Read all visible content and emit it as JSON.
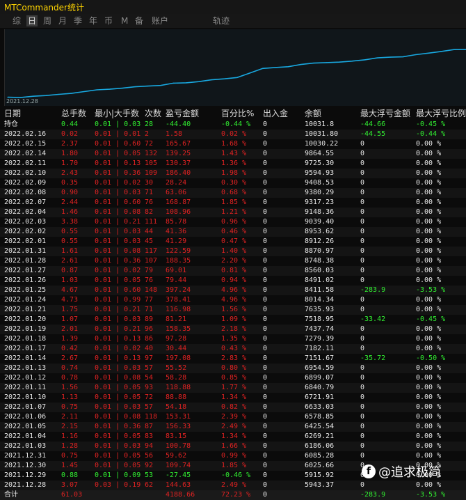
{
  "app": {
    "title": "MTCommander统计"
  },
  "tabs": [
    "综",
    "日",
    "周",
    "月",
    "季",
    "年",
    "币",
    "M",
    "备",
    "账户",
    "轨迹"
  ],
  "active_tab": "日",
  "chart": {
    "date_label": "2021.12.28"
  },
  "chart_data": {
    "type": "line",
    "x": [
      "2021.12.28",
      "2021.12.29",
      "2021.12.30",
      "2021.12.31",
      "2022.01.03",
      "2022.01.04",
      "2022.01.05",
      "2022.01.06",
      "2022.01.07",
      "2022.01.10",
      "2022.01.11",
      "2022.01.12",
      "2022.01.13",
      "2022.01.14",
      "2022.01.17",
      "2022.01.18",
      "2022.01.19",
      "2022.01.20",
      "2022.01.21",
      "2022.01.24",
      "2022.01.25",
      "2022.01.26",
      "2022.01.27",
      "2022.01.28",
      "2022.01.31",
      "2022.02.01",
      "2022.02.02",
      "2022.02.03",
      "2022.02.04",
      "2022.02.07",
      "2022.02.08",
      "2022.02.09",
      "2022.02.10",
      "2022.02.11",
      "2022.02.14",
      "2022.02.15",
      "2022.02.16"
    ],
    "series": [
      {
        "values": [
          5943.37,
          5915.92,
          6025.66,
          6085.28,
          6186.06,
          6269.21,
          6425.54,
          6578.85,
          6633.03,
          6721.91,
          6840.79,
          6899.07,
          6954.59,
          7151.67,
          7182.11,
          7279.39,
          7437.74,
          7518.95,
          7635.93,
          8014.34,
          8411.58,
          8491.02,
          8560.03,
          8748.38,
          8870.97,
          8912.26,
          8953.62,
          9039.4,
          9148.36,
          9317.23,
          9380.29,
          9408.53,
          9594.93,
          9725.3,
          9864.55,
          10030.22,
          10031.8
        ]
      }
    ]
  },
  "columns": [
    "日期",
    "总手数",
    "最小|大手数",
    "次数",
    "盈亏金额",
    "百分比%",
    "出入金",
    "余额",
    "最大浮亏金额",
    "最大浮亏比例"
  ],
  "holding": {
    "date": "持仓",
    "lots": "0.44",
    "minmax": "0.01 | 0.03",
    "count": "28",
    "pl": "-44.40",
    "pct": "-0.44 %",
    "io": "0",
    "bal": "10031.8",
    "fl": "-44.66",
    "flp": "-0.45 %"
  },
  "rows": [
    [
      "2022.02.16",
      "0.02",
      "0.01 | 0.01",
      "2",
      "1.58",
      "0.02 %",
      "0",
      "10031.80",
      "-44.55",
      "-0.44 %"
    ],
    [
      "2022.02.15",
      "2.37",
      "0.01 | 0.60",
      "72",
      "165.67",
      "1.68 %",
      "0",
      "10030.22",
      "0",
      "0.00 %"
    ],
    [
      "2022.02.14",
      "1.80",
      "0.01 | 0.05",
      "132",
      "139.25",
      "1.43 %",
      "0",
      "9864.55",
      "0",
      "0.00 %"
    ],
    [
      "2022.02.11",
      "1.70",
      "0.01 | 0.13",
      "105",
      "130.37",
      "1.36 %",
      "0",
      "9725.30",
      "0",
      "0.00 %"
    ],
    [
      "2022.02.10",
      "2.43",
      "0.01 | 0.36",
      "109",
      "186.40",
      "1.98 %",
      "0",
      "9594.93",
      "0",
      "0.00 %"
    ],
    [
      "2022.02.09",
      "0.35",
      "0.01 | 0.02",
      "30",
      "28.24",
      "0.30 %",
      "0",
      "9408.53",
      "0",
      "0.00 %"
    ],
    [
      "2022.02.08",
      "0.90",
      "0.01 | 0.03",
      "71",
      "63.06",
      "0.68 %",
      "0",
      "9380.29",
      "0",
      "0.00 %"
    ],
    [
      "2022.02.07",
      "2.44",
      "0.01 | 0.60",
      "76",
      "168.87",
      "1.85 %",
      "0",
      "9317.23",
      "0",
      "0.00 %"
    ],
    [
      "2022.02.04",
      "1.46",
      "0.01 | 0.08",
      "82",
      "108.96",
      "1.21 %",
      "0",
      "9148.36",
      "0",
      "0.00 %"
    ],
    [
      "2022.02.03",
      "3.38",
      "0.01 | 0.21",
      "111",
      "85.78",
      "0.96 %",
      "0",
      "9039.40",
      "0",
      "0.00 %"
    ],
    [
      "2022.02.02",
      "0.55",
      "0.01 | 0.03",
      "44",
      "41.36",
      "0.46 %",
      "0",
      "8953.62",
      "0",
      "0.00 %"
    ],
    [
      "2022.02.01",
      "0.55",
      "0.01 | 0.03",
      "45",
      "41.29",
      "0.47 %",
      "0",
      "8912.26",
      "0",
      "0.00 %"
    ],
    [
      "2022.01.31",
      "1.61",
      "0.01 | 0.08",
      "117",
      "122.59",
      "1.40 %",
      "0",
      "8870.97",
      "0",
      "0.00 %"
    ],
    [
      "2022.01.28",
      "2.61",
      "0.01 | 0.36",
      "107",
      "188.35",
      "2.20 %",
      "0",
      "8748.38",
      "0",
      "0.00 %"
    ],
    [
      "2022.01.27",
      "0.87",
      "0.01 | 0.02",
      "79",
      "69.01",
      "0.81 %",
      "0",
      "8560.03",
      "0",
      "0.00 %"
    ],
    [
      "2022.01.26",
      "1.03",
      "0.01 | 0.05",
      "76",
      "79.44",
      "0.94 %",
      "0",
      "8491.02",
      "0",
      "0.00 %"
    ],
    [
      "2022.01.25",
      "4.67",
      "0.01 | 0.60",
      "148",
      "397.24",
      "4.96 %",
      "0",
      "8411.58",
      "-283.9",
      "-3.53 %"
    ],
    [
      "2022.01.24",
      "4.73",
      "0.01 | 0.99",
      "77",
      "378.41",
      "4.96 %",
      "0",
      "8014.34",
      "0",
      "0.00 %"
    ],
    [
      "2022.01.21",
      "1.75",
      "0.01 | 0.21",
      "71",
      "116.98",
      "1.56 %",
      "0",
      "7635.93",
      "0",
      "0.00 %"
    ],
    [
      "2022.01.20",
      "1.07",
      "0.01 | 0.03",
      "89",
      "81.21",
      "1.09 %",
      "0",
      "7518.95",
      "-33.42",
      "-0.45 %"
    ],
    [
      "2022.01.19",
      "2.01",
      "0.01 | 0.21",
      "96",
      "158.35",
      "2.18 %",
      "0",
      "7437.74",
      "0",
      "0.00 %"
    ],
    [
      "2022.01.18",
      "1.39",
      "0.01 | 0.13",
      "86",
      "97.28",
      "1.35 %",
      "0",
      "7279.39",
      "0",
      "0.00 %"
    ],
    [
      "2022.01.17",
      "0.42",
      "0.01 | 0.02",
      "40",
      "30.44",
      "0.43 %",
      "0",
      "7182.11",
      "0",
      "0.00 %"
    ],
    [
      "2022.01.14",
      "2.67",
      "0.01 | 0.13",
      "97",
      "197.08",
      "2.83 %",
      "0",
      "7151.67",
      "-35.72",
      "-0.50 %"
    ],
    [
      "2022.01.13",
      "0.74",
      "0.01 | 0.03",
      "57",
      "55.52",
      "0.80 %",
      "0",
      "6954.59",
      "0",
      "0.00 %"
    ],
    [
      "2022.01.12",
      "0.78",
      "0.01 | 0.08",
      "54",
      "58.28",
      "0.85 %",
      "0",
      "6899.07",
      "0",
      "0.00 %"
    ],
    [
      "2022.01.11",
      "1.56",
      "0.01 | 0.05",
      "93",
      "118.88",
      "1.77 %",
      "0",
      "6840.79",
      "0",
      "0.00 %"
    ],
    [
      "2022.01.10",
      "1.13",
      "0.01 | 0.05",
      "72",
      "88.88",
      "1.34 %",
      "0",
      "6721.91",
      "0",
      "0.00 %"
    ],
    [
      "2022.01.07",
      "0.75",
      "0.01 | 0.03",
      "57",
      "54.18",
      "0.82 %",
      "0",
      "6633.03",
      "0",
      "0.00 %"
    ],
    [
      "2022.01.06",
      "2.11",
      "0.01 | 0.08",
      "118",
      "153.31",
      "2.39 %",
      "0",
      "6578.85",
      "0",
      "0.00 %"
    ],
    [
      "2022.01.05",
      "2.15",
      "0.01 | 0.36",
      "87",
      "156.33",
      "2.49 %",
      "0",
      "6425.54",
      "0",
      "0.00 %"
    ],
    [
      "2022.01.04",
      "1.16",
      "0.01 | 0.05",
      "83",
      "83.15",
      "1.34 %",
      "0",
      "6269.21",
      "0",
      "0.00 %"
    ],
    [
      "2022.01.03",
      "1.28",
      "0.01 | 0.03",
      "94",
      "100.78",
      "1.66 %",
      "0",
      "6186.06",
      "0",
      "0.00 %"
    ],
    [
      "2021.12.31",
      "0.75",
      "0.01 | 0.05",
      "56",
      "59.62",
      "0.99 %",
      "0",
      "6085.28",
      "0",
      "0.00 %"
    ],
    [
      "2021.12.30",
      "1.45",
      "0.01 | 0.05",
      "92",
      "109.74",
      "1.85 %",
      "0",
      "6025.66",
      "0",
      "0.00 %"
    ],
    [
      "2021.12.29",
      "0.88",
      "0.01 | 0.09",
      "53",
      "-27.45",
      "-0.46 %",
      "0",
      "5915.92",
      "0",
      "0.00 %"
    ],
    [
      "2021.12.28",
      "3.07",
      "0.03 | 0.19",
      "62",
      "144.63",
      "2.49 %",
      "0",
      "5943.37",
      "0",
      "0.00 %"
    ]
  ],
  "footer": {
    "label": "合计",
    "lots": "61.03",
    "pl": "4188.66",
    "pct": "72.23 %",
    "io": "0",
    "fl": "-283.9",
    "flp": "-3.53 %"
  },
  "watermark": {
    "text": "@追求极简"
  }
}
